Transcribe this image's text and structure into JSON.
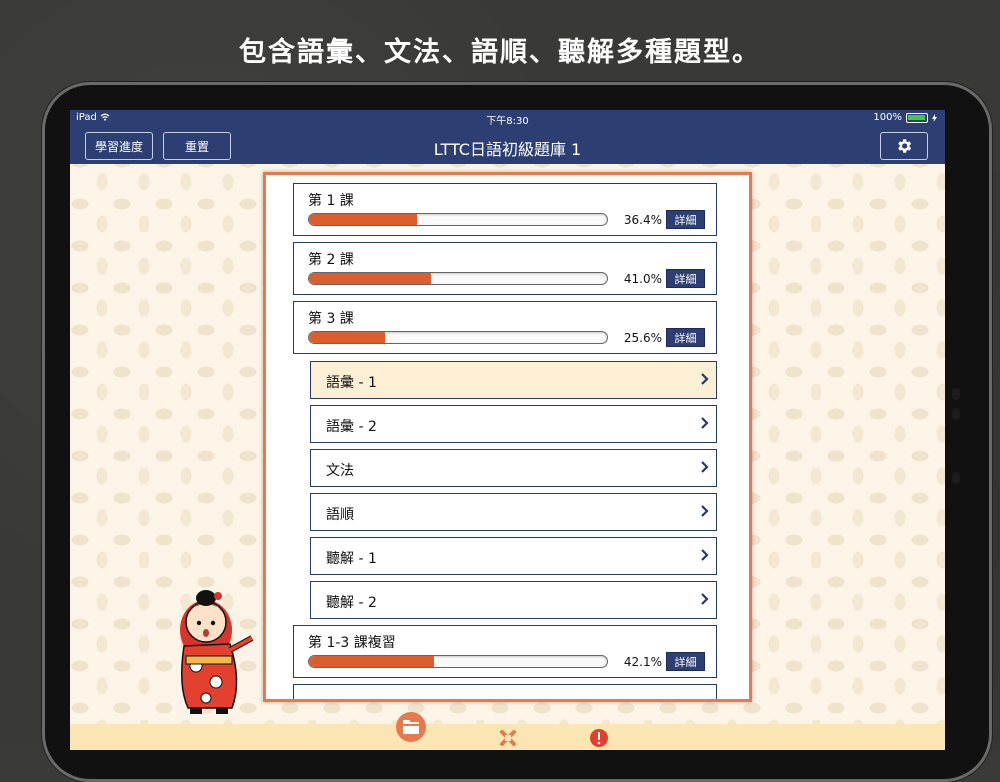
{
  "promo": {
    "caption": "包含語彙、文法、語順、聽解多種題型。"
  },
  "status": {
    "device": "iPad",
    "time": "下午8:30",
    "battery": "100%"
  },
  "nav": {
    "progress_label": "學習進度",
    "reset_label": "重置",
    "title": "LTTC日語初級題庫 1",
    "settings_icon": "gear-icon"
  },
  "lessons": [
    {
      "title": "第 1 課",
      "percent": "36.4%",
      "progress": 0.364,
      "detail": "詳細"
    },
    {
      "title": "第 2 課",
      "percent": "41.0%",
      "progress": 0.41,
      "detail": "詳細"
    },
    {
      "title": "第 3 課",
      "percent": "25.6%",
      "progress": 0.256,
      "detail": "詳細"
    }
  ],
  "subitems": [
    {
      "label": "語彙 - 1",
      "selected": true
    },
    {
      "label": "語彙 - 2",
      "selected": false
    },
    {
      "label": "文法",
      "selected": false
    },
    {
      "label": "語順",
      "selected": false
    },
    {
      "label": "聽解 - 1",
      "selected": false
    },
    {
      "label": "聽解 - 2",
      "selected": false
    }
  ],
  "review": {
    "title": "第 1-3 課複習",
    "percent": "42.1%",
    "progress": 0.421,
    "detail": "詳細"
  },
  "tabs": [
    {
      "icon": "folder-icon",
      "active": true
    },
    {
      "icon": "tools-icon",
      "active": false
    },
    {
      "icon": "alert-icon",
      "active": false
    }
  ],
  "colors": {
    "navbar": "#2d3e72",
    "accent": "#e57a4c",
    "progress": "#dc5d2d",
    "selected_row": "#fcefd3"
  }
}
